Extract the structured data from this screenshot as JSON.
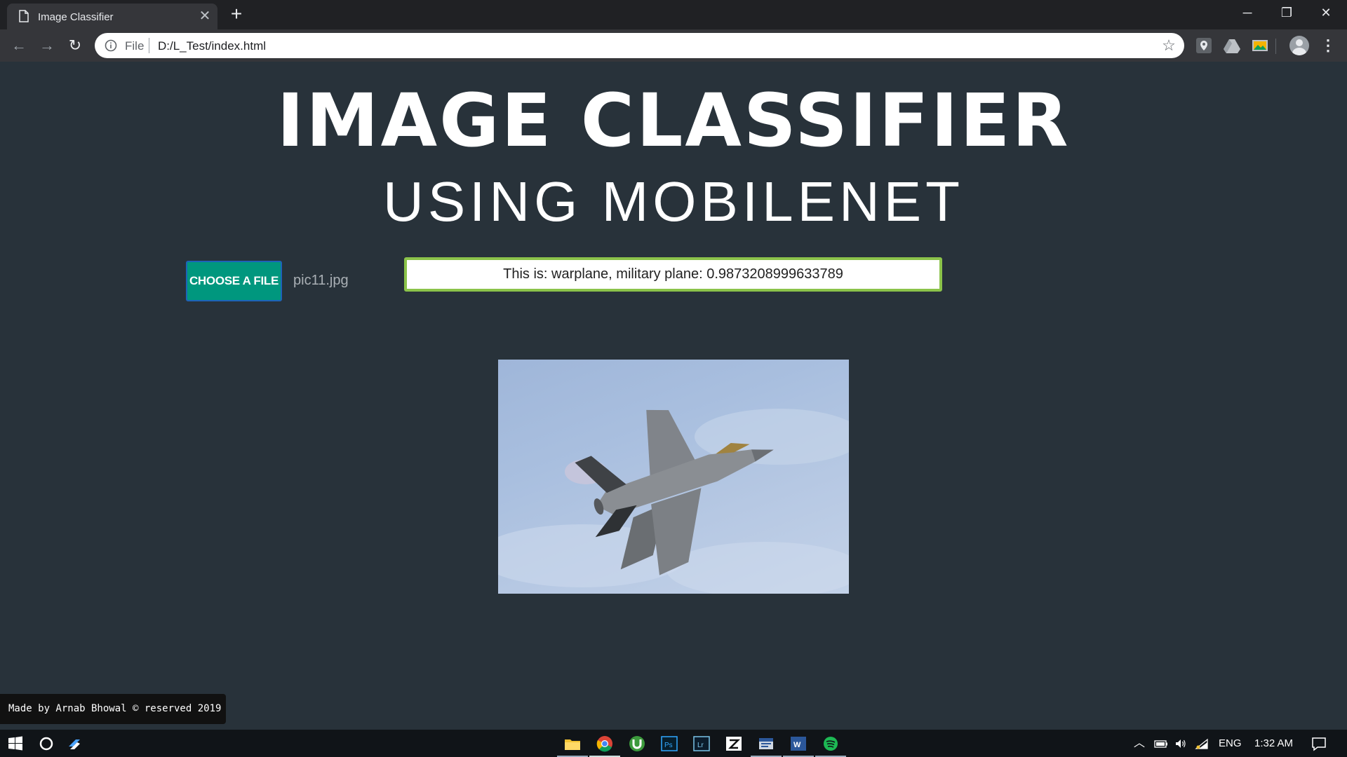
{
  "browser": {
    "tab_title": "Image Classifier",
    "tab_close": "✕",
    "new_tab": "+",
    "scheme_label": "File",
    "url": "D:/L_Test/index.html",
    "window_controls": {
      "minimize": "─",
      "restore": "❐",
      "close": "✕"
    },
    "nav": {
      "back": "←",
      "forward": "→",
      "reload": "↻"
    },
    "menu": "⋮",
    "star": "☆"
  },
  "page": {
    "title": "IMAGE CLASSIFIER",
    "subtitle": "USING MOBILENET",
    "choose_button_label": "CHOOSE A FILE",
    "selected_file": "pic11.jpg",
    "result_text": "This is: warplane, military plane: 0.9873208999633789",
    "footer": "Made by Arnab Bhowal © reserved 2019"
  },
  "taskbar": {
    "pinned_apps": [
      "start-icon",
      "cortana-icon",
      "task-view-icon",
      "file-explorer-icon",
      "chrome-icon",
      "utorrent-icon",
      "photoshop-icon",
      "lightroom-icon",
      "zotero-icon",
      "outlook-icon",
      "word-icon",
      "spotify-icon"
    ],
    "language": "ENG",
    "time": "1:32 AM"
  },
  "colors": {
    "page_background": "#28323a",
    "button_teal": "#00977e",
    "result_border": "#8bc34a"
  }
}
